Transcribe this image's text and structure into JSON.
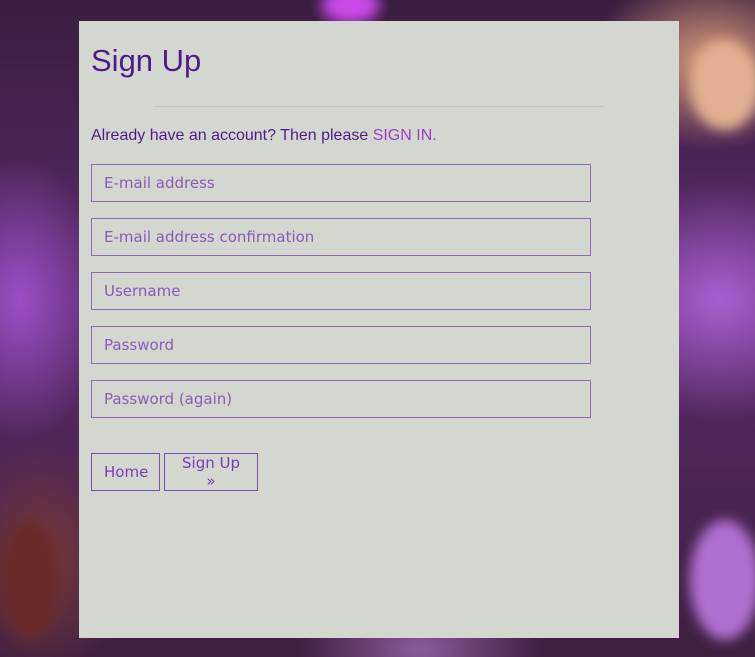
{
  "form": {
    "title": "Sign Up",
    "signin_prompt": "Already have an account? Then please ",
    "signin_link": "SIGN IN",
    "signin_suffix": ".",
    "fields": {
      "email": {
        "placeholder": "E-mail address",
        "value": ""
      },
      "email_confirm": {
        "placeholder": "E-mail address confirmation",
        "value": ""
      },
      "username": {
        "placeholder": "Username",
        "value": ""
      },
      "password": {
        "placeholder": "Password",
        "value": ""
      },
      "password_again": {
        "placeholder": "Password (again)",
        "value": ""
      }
    },
    "buttons": {
      "home_label": "Home",
      "signup_label": "Sign Up »"
    }
  },
  "colors": {
    "title": "#4e1c8a",
    "link": "#9b3fc8",
    "panel_bg": "#d3d7d0",
    "field_border": "#8f6bb5"
  }
}
